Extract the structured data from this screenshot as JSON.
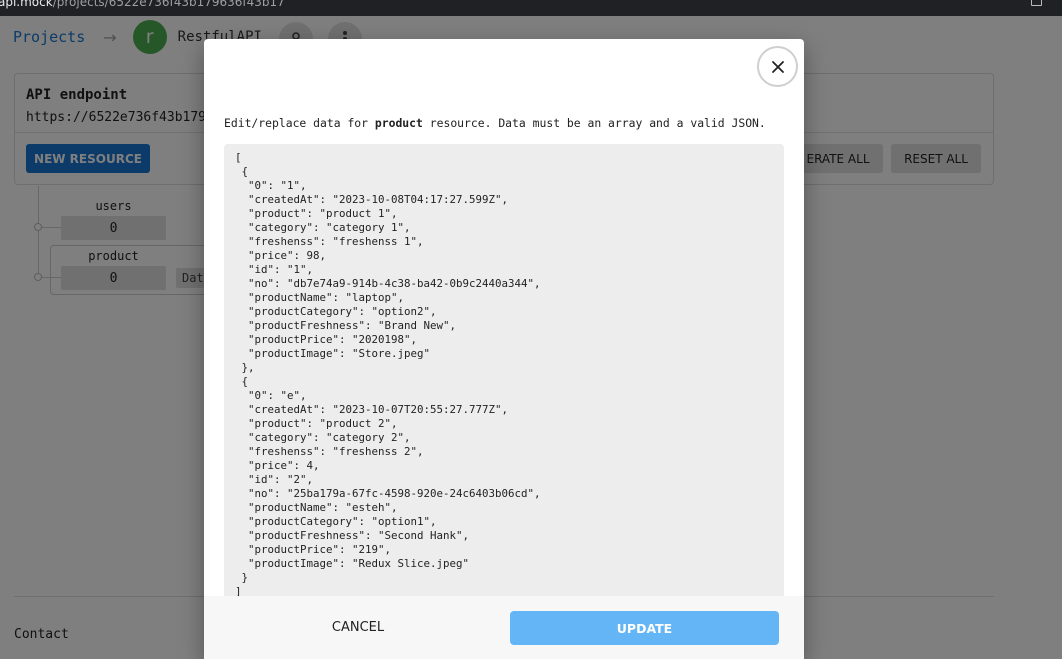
{
  "browser": {
    "url_host": "api.mock",
    "url_path": "/projects/6522e736f43b179636f43b17"
  },
  "breadcrumb": {
    "projects_label": "Projects",
    "arrow": "→",
    "avatar_letter": "r",
    "project_name": "RestfulAPI"
  },
  "endpoint": {
    "title": "API endpoint",
    "url": "https://6522e736f43b179"
  },
  "actions": {
    "new_resource": "NEW RESOURCE",
    "generate_all": "ERATE ALL",
    "reset_all": "RESET ALL"
  },
  "resources": [
    {
      "name": "users",
      "count": "0"
    },
    {
      "name": "product",
      "count": "0",
      "chip": "Data"
    }
  ],
  "footer": {
    "contact": "Contact"
  },
  "modal": {
    "description_before": "Edit/replace data for ",
    "resource_name": "product",
    "description_after": " resource. Data must be an array and a valid JSON.",
    "json_text": "[\n {\n  \"0\": \"1\",\n  \"createdAt\": \"2023-10-08T04:17:27.599Z\",\n  \"product\": \"product 1\",\n  \"category\": \"category 1\",\n  \"freshenss\": \"freshenss 1\",\n  \"price\": 98,\n  \"id\": \"1\",\n  \"no\": \"db7e74a9-914b-4c38-ba42-0b9c2440a344\",\n  \"productName\": \"laptop\",\n  \"productCategory\": \"option2\",\n  \"productFreshness\": \"Brand New\",\n  \"productPrice\": \"2020198\",\n  \"productImage\": \"Store.jpeg\"\n },\n {\n  \"0\": \"e\",\n  \"createdAt\": \"2023-10-07T20:55:27.777Z\",\n  \"product\": \"product 2\",\n  \"category\": \"category 2\",\n  \"freshenss\": \"freshenss 2\",\n  \"price\": 4,\n  \"id\": \"2\",\n  \"no\": \"25ba179a-67fc-4598-920e-24c6403b06cd\",\n  \"productName\": \"esteh\",\n  \"productCategory\": \"option1\",\n  \"productFreshness\": \"Second Hank\",\n  \"productPrice\": \"219\",\n  \"productImage\": \"Redux Slice.jpeg\"\n }\n]",
    "cancel_label": "CANCEL",
    "update_label": "UPDATE"
  },
  "icons": {
    "close": "close-icon",
    "users": "users-icon",
    "more": "more-vert-icon"
  },
  "colors": {
    "primary": "#1976d2",
    "update_disabled": "#64b5f6",
    "avatar": "#4caf50"
  }
}
